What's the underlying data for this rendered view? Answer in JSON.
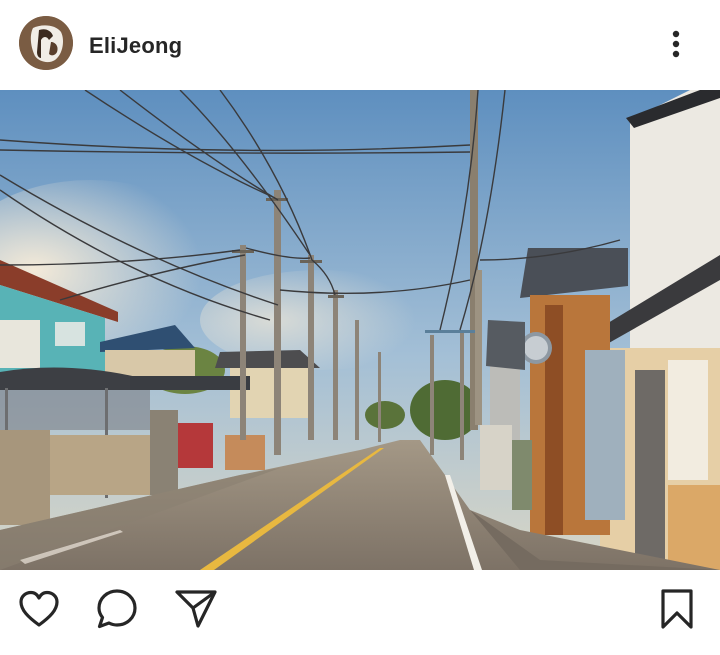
{
  "post": {
    "username": "EliJeong",
    "avatar_icon": "avatar-photo",
    "more_icon": "more-vertical-icon",
    "image_description_icon": "street-scene-photo"
  },
  "actions": {
    "like_icon": "heart-icon",
    "comment_icon": "comment-icon",
    "share_icon": "send-icon",
    "save_icon": "bookmark-icon"
  },
  "colors": {
    "text_primary": "#262626",
    "background": "#ffffff"
  }
}
